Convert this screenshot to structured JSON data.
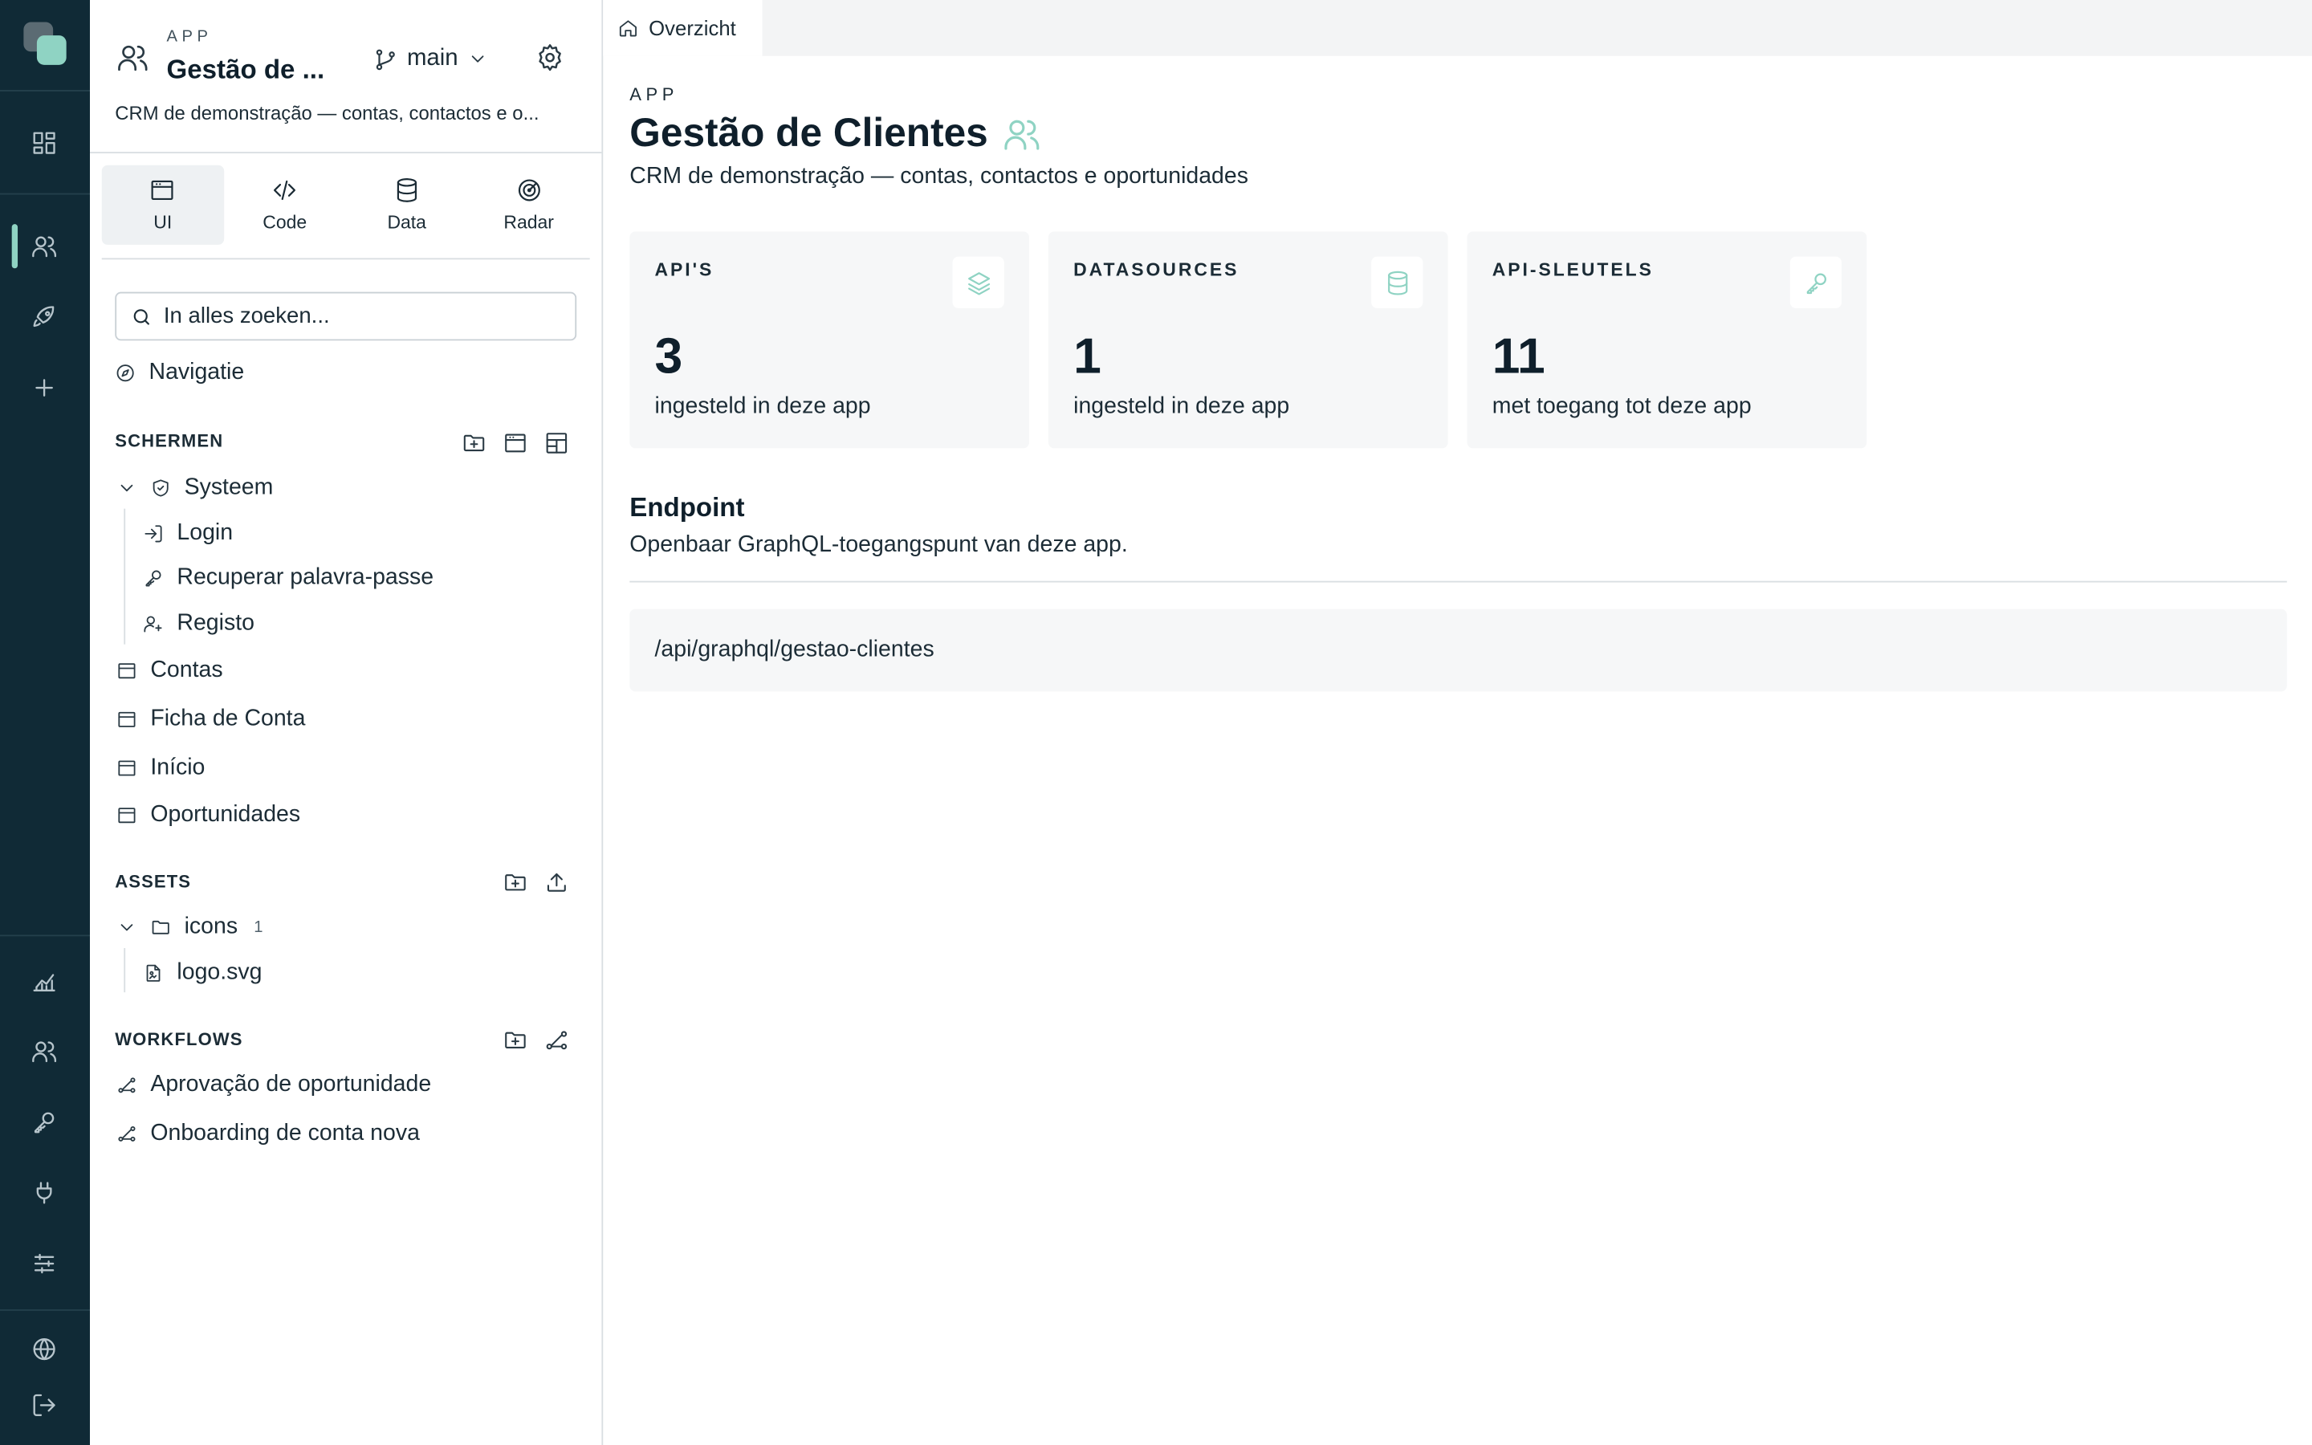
{
  "rail": {
    "items": [
      "logo",
      "dashboard-icon",
      "users-icon",
      "rocket-icon",
      "plus-icon",
      "chart-icon",
      "users-icon",
      "key-icon",
      "plug-icon",
      "sliders-icon",
      "globe-icon",
      "logout-icon"
    ]
  },
  "sidebar": {
    "eyebrow": "APP",
    "title": "Gestão de ...",
    "branch": "main",
    "description": "CRM de demonstração — contas, contactos e o...",
    "tabs": [
      {
        "label": "UI",
        "icon": "window-icon",
        "active": true
      },
      {
        "label": "Code",
        "icon": "code-icon",
        "active": false
      },
      {
        "label": "Data",
        "icon": "database-icon",
        "active": false
      },
      {
        "label": "Radar",
        "icon": "radar-icon",
        "active": false
      }
    ],
    "search_placeholder": "In alles zoeken...",
    "navigation_label": "Navigatie",
    "screens": {
      "heading": "SCHERMEN",
      "folder": "Systeem",
      "folder_items": [
        "Login",
        "Recuperar palavra-passe",
        "Registo"
      ],
      "items": [
        "Contas",
        "Ficha de Conta",
        "Início",
        "Oportunidades"
      ]
    },
    "assets": {
      "heading": "ASSETS",
      "folder": "icons",
      "folder_count": "1",
      "folder_items": [
        "logo.svg"
      ]
    },
    "workflows": {
      "heading": "WORKFLOWS",
      "items": [
        "Aprovação de oportunidade",
        "Onboarding de conta nova"
      ]
    }
  },
  "main": {
    "tab_label": "Overzicht",
    "eyebrow": "APP",
    "title": "Gestão de Clientes",
    "subtitle": "CRM de demonstração — contas, contactos e oportunidades",
    "cards": [
      {
        "label": "API'S",
        "value": "3",
        "caption": "ingesteld in deze app",
        "icon": "layers-icon"
      },
      {
        "label": "DATASOURCES",
        "value": "1",
        "caption": "ingesteld in deze app",
        "icon": "database-icon"
      },
      {
        "label": "API-SLEUTELS",
        "value": "11",
        "caption": "met toegang tot deze app",
        "icon": "key-icon"
      }
    ],
    "endpoint": {
      "title": "Endpoint",
      "description": "Openbaar GraphQL-toegangspunt van deze app.",
      "path": "/api/graphql/gestao-clientes"
    }
  },
  "colors": {
    "rail_bg": "#102a36",
    "accent": "#8fd3c3",
    "card_bg": "#f6f7f8"
  }
}
